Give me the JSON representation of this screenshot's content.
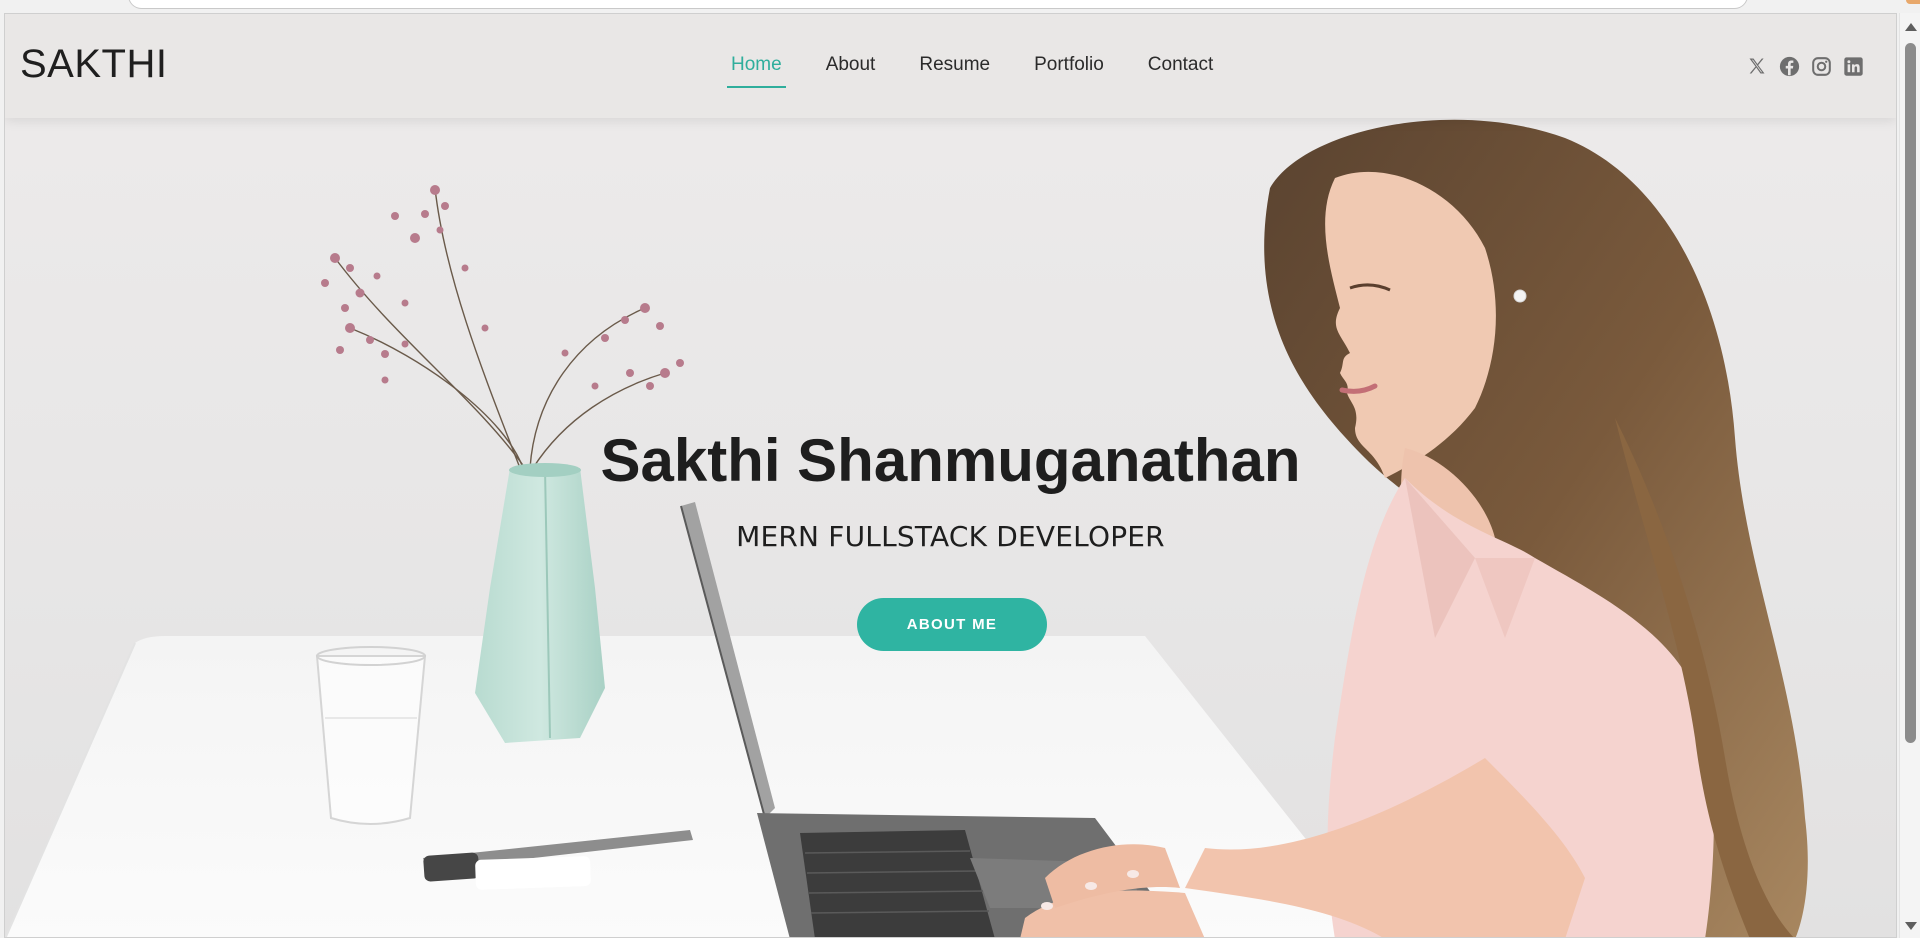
{
  "header": {
    "logo": "SAKTHI",
    "nav": [
      {
        "label": "Home",
        "active": true
      },
      {
        "label": "About",
        "active": false
      },
      {
        "label": "Resume",
        "active": false
      },
      {
        "label": "Portfolio",
        "active": false
      },
      {
        "label": "Contact",
        "active": false
      }
    ],
    "socials": [
      "x-twitter-icon",
      "facebook-icon",
      "instagram-icon",
      "linkedin-icon"
    ]
  },
  "hero": {
    "title": "Sakthi Shanmuganathan",
    "subtitle": "MERN FULLSTACK DEVELOPER",
    "button_label": "ABOUT ME"
  },
  "colors": {
    "accent": "#2fb4a2",
    "header_bg": "#e9e7e6",
    "text": "#1e1e1e"
  }
}
